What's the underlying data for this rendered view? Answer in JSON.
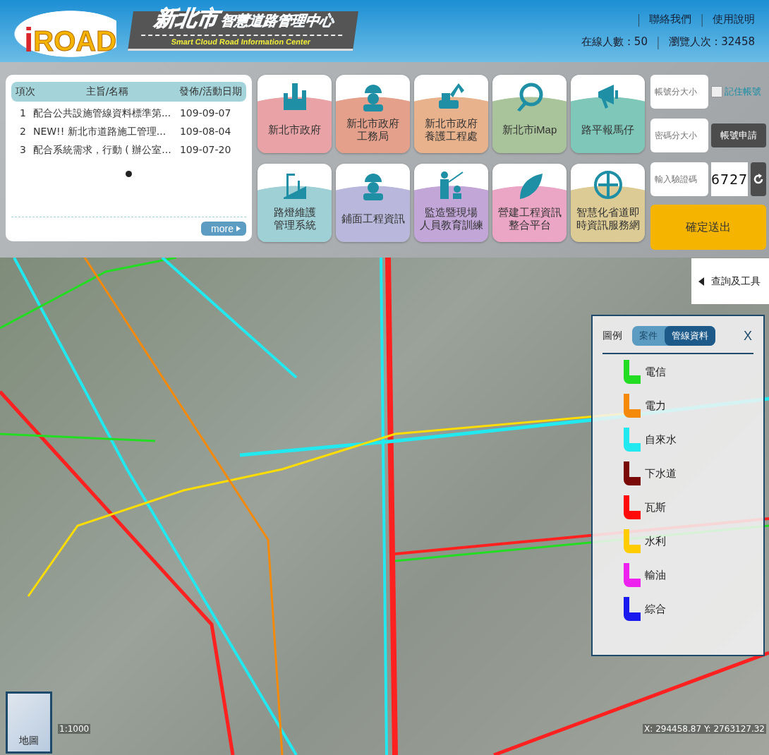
{
  "header": {
    "logo": {
      "letter": "i",
      "word": "ROAD"
    },
    "title_city": "新北市",
    "title_rest": "智慧道路管理中心",
    "subtitle": "Smart Cloud Road Information Center",
    "nav": [
      {
        "kind": "sep",
        "text": "|"
      },
      {
        "kind": "link",
        "text": "聯絡我們"
      },
      {
        "kind": "sep",
        "text": "|"
      },
      {
        "kind": "link",
        "text": "使用說明"
      }
    ],
    "stats": [
      {
        "kind": "stat",
        "text": "在線人數 : 50"
      },
      {
        "kind": "sep",
        "text": "|"
      },
      {
        "kind": "stat",
        "text": "瀏覽人次 : 32458"
      }
    ]
  },
  "news": {
    "columns": [
      "項次",
      "主旨/名稱",
      "發佈/活動日期"
    ],
    "rows": [
      {
        "no": "1",
        "title": "配合公共設施管線資料標準第...",
        "date": "109-09-07"
      },
      {
        "no": "2",
        "title": "NEW!! 新北市道路施工管理...",
        "date": "109-08-04"
      },
      {
        "no": "3",
        "title": "配合系統需求，行動 ( 辦公室...",
        "date": "109-07-20"
      }
    ],
    "dots": [
      {
        "selected": true
      }
    ],
    "more": "more"
  },
  "tiles": [
    {
      "lines": [
        "新北市政府"
      ],
      "color": "#e9a3a6"
    },
    {
      "lines": [
        "新北市政府",
        "工務局"
      ],
      "color": "#e4a08a"
    },
    {
      "lines": [
        "新北市政府",
        "養護工程處"
      ],
      "color": "#e8b28c"
    },
    {
      "lines": [
        "新北市iMap"
      ],
      "color": "#a9c49a"
    },
    {
      "lines": [
        "路平報馬仔"
      ],
      "color": "#7fc8b9"
    },
    {
      "lines": [
        "路燈維護",
        "管理系統"
      ],
      "color": "#9fd0d6"
    },
    {
      "lines": [
        "鋪面工程資訊"
      ],
      "color": "#b9b8dc"
    },
    {
      "lines": [
        "監造暨現場",
        "人員教育訓練"
      ],
      "color": "#c2a6d8"
    },
    {
      "lines": [
        "營建工程資訊",
        "整合平台"
      ],
      "color": "#eaa6c4"
    },
    {
      "lines": [
        "智慧化省道即",
        "時資訊服務網"
      ],
      "color": "#dccb94"
    }
  ],
  "login": {
    "account": {
      "placeholder": "帳號分大小"
    },
    "remember": {
      "label": "記住帳號",
      "checked": false
    },
    "password": {
      "placeholder": "密碼分大小"
    },
    "register": "帳號申請",
    "captcha_input": {
      "placeholder": "輸入驗證碼"
    },
    "captcha": "6727",
    "submit": "確定送出"
  },
  "map": {
    "tools": "查詢及工具",
    "scale": "1:1000",
    "coords": "X: 294458.87 Y: 2763127.32",
    "basemap": "地圖",
    "legend": {
      "title": "圖例",
      "tabs": [
        {
          "label": "案件",
          "selected": false
        },
        {
          "label": "管線資料",
          "selected": true
        }
      ],
      "close": "X",
      "items": [
        {
          "label": "電信",
          "color": "#22dd22"
        },
        {
          "label": "電力",
          "color": "#f58a0a"
        },
        {
          "label": "自來水",
          "color": "#22e8f0"
        },
        {
          "label": "下水道",
          "color": "#7a0a0a"
        },
        {
          "label": "瓦斯",
          "color": "#ff0a0a"
        },
        {
          "label": "水利",
          "color": "#ffcc00"
        },
        {
          "label": "輸油",
          "color": "#ee22ee"
        },
        {
          "label": "綜合",
          "color": "#1a1aee"
        }
      ]
    }
  }
}
